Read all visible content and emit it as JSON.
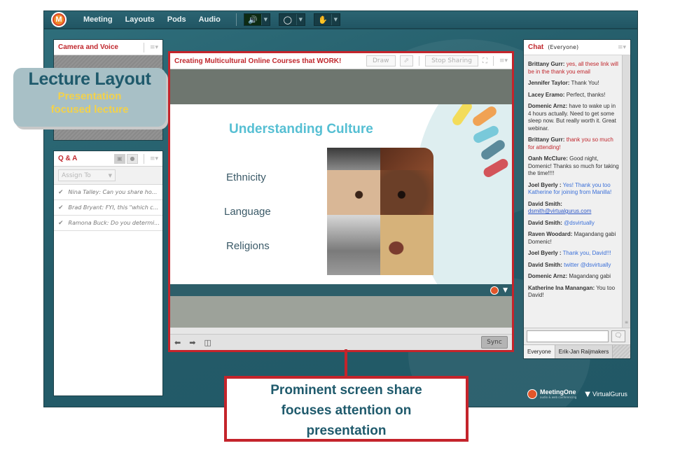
{
  "topbar": {
    "logo": "meetingone-logo-icon",
    "menu": [
      "Meeting",
      "Layouts",
      "Pods",
      "Audio"
    ],
    "buttons": [
      {
        "name": "audio-speaker",
        "icon": "speaker-icon",
        "active": true
      },
      {
        "name": "webcam",
        "icon": "webcam-icon",
        "active": false
      },
      {
        "name": "raise-hand",
        "icon": "raise-hand-icon",
        "active": false
      }
    ]
  },
  "camera_pod": {
    "title": "Camera and Voice"
  },
  "qa_pod": {
    "title": "Q & A",
    "assign_placeholder": "Assign To",
    "items": [
      "Nina Talley: Can you share ho...",
      "Brad Bryant: FYI, this \"which c...",
      "Ramona Buck: Do you determi..."
    ]
  },
  "share_pod": {
    "title": "Creating Multicultural Online Courses that WORK!",
    "draw_label": "Draw",
    "stop_sharing_label": "Stop Sharing",
    "sync_label": "Sync",
    "slide": {
      "title": "Understanding Culture",
      "bullets": [
        "Ethnicity",
        "Language",
        "Religions"
      ]
    }
  },
  "chat_pod": {
    "title": "Chat",
    "subtitle": "(Everyone)",
    "messages": [
      {
        "from": "Brittany Gurr:",
        "text": "yes, all these link will be in the thank you email",
        "style": "red"
      },
      {
        "from": "Jennifer Taylor:",
        "text": "Thank You!",
        "style": "plain"
      },
      {
        "from": "Lacey Eramo:",
        "text": "Perfect, thanks!",
        "style": "plain"
      },
      {
        "from": "Domenic Arnz:",
        "text": "have to wake up in 4 hours actually. Need to get some sleep now. But really worth it. Great webinar.",
        "style": "plain"
      },
      {
        "from": "Brittany Gurr:",
        "text": "thank you so much for attending!",
        "style": "red"
      },
      {
        "from": "Oanh McClure:",
        "text": "Good night, Domenic! Thanks so much for taking the time!!!!",
        "style": "plain"
      },
      {
        "from": "Joel  Byerly :",
        "text": "Yes!  Thank you too Katherine for joining from Manilla!",
        "style": "blue"
      },
      {
        "from": "David Smith:",
        "text": "dsmith@virtualgurus.com",
        "style": "link"
      },
      {
        "from": "David Smith:",
        "text": "@dsvirtually",
        "style": "blue"
      },
      {
        "from": "Raven Woodard:",
        "text": "Magandang gabi Domenic!",
        "style": "plain"
      },
      {
        "from": "Joel  Byerly :",
        "text": "Thank you, David!!!",
        "style": "blue"
      },
      {
        "from": "David Smith:",
        "text": "twitter @dsvirtually",
        "style": "blue"
      },
      {
        "from": "Domenic Arnz:",
        "text": "Magandang gabi",
        "style": "plain"
      },
      {
        "from": " Katherine Ina Manangan:",
        "text": "You too David!",
        "style": "plain"
      }
    ],
    "input_value": "",
    "tabs": [
      "Everyone",
      "Erik-Jan Raijmakers"
    ]
  },
  "branding": {
    "meetingone": "MeetingOne",
    "meetingone_tag": "audio & web conferencing",
    "virtualgurus": "VirtualGurus"
  },
  "annotations": {
    "lecture_heading": "Lecture Layout",
    "lecture_sub_1": "Presentation",
    "lecture_sub_2": "focused lecture",
    "share_note_1": "Prominent screen share",
    "share_note_2": "focuses attention on",
    "share_note_3": "presentation"
  },
  "colors": {
    "accent_red": "#c4242b",
    "app_teal": "#245c69",
    "slide_title": "#56bfd3",
    "callout_yellow": "#f2d14b"
  }
}
